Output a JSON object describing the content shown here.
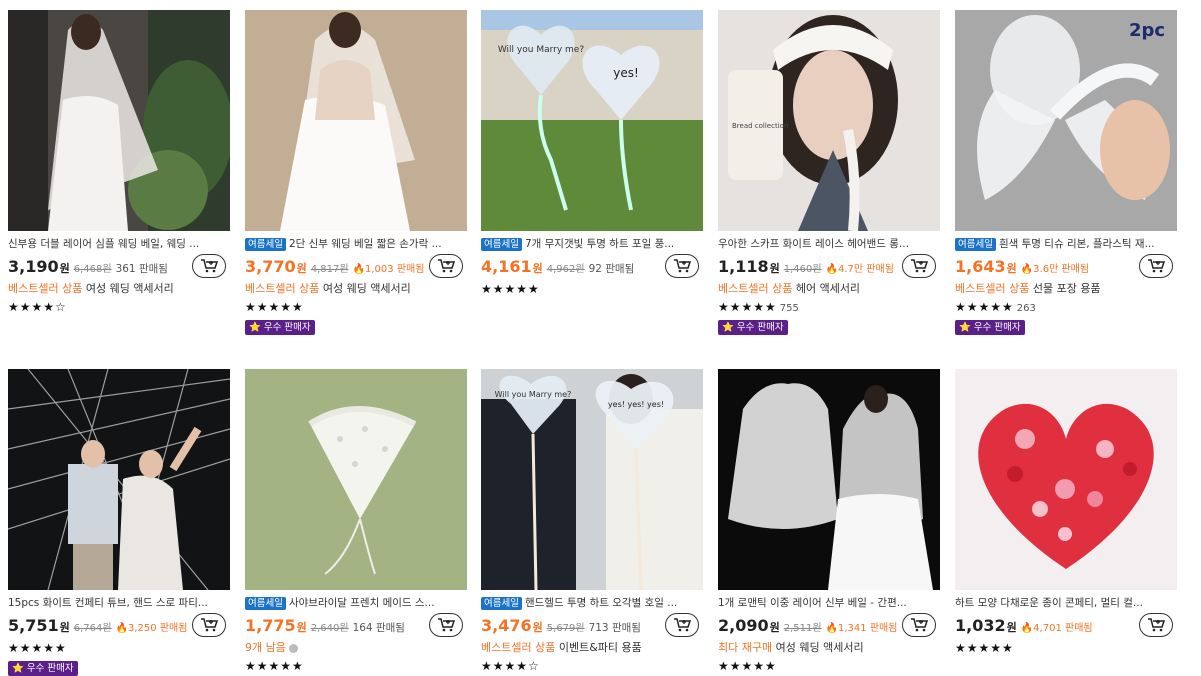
{
  "products": [
    {
      "title": "신부용 더블 레이어 심플 웨딩 베일, 웨딩 ...",
      "sale": false,
      "price": "3,190",
      "price_color": "black",
      "won": "원",
      "old": "6,468원",
      "fire": "",
      "sold": "361 판매됨",
      "line3_hi": "베스트셀러 상품",
      "line3_rest": " 여성 웨딩 액세서리",
      "stars": "★★★★☆",
      "reviews": "",
      "seller": ""
    },
    {
      "title": "2단 신부 웨딩 베일 짧은 손가락 ...",
      "sale": true,
      "price": "3,770",
      "price_color": "orange",
      "won": "원",
      "old": "4,817원",
      "fire": "🔥1,003 판매됨",
      "sold": "",
      "line3_hi": "베스트셀러 상품",
      "line3_rest": " 여성 웨딩 액세서리",
      "stars": "★★★★★",
      "reviews": "",
      "seller": "⭐ 우수 판매자"
    },
    {
      "title": "7개 무지갯빛 투명 하트 포일 풍...",
      "sale": true,
      "price": "4,161",
      "price_color": "orange",
      "won": "원",
      "old": "4,962원",
      "fire": "",
      "sold": "92 판매됨",
      "line3_hi": "",
      "line3_rest": "",
      "stars": "★★★★★",
      "reviews": "",
      "seller": ""
    },
    {
      "title": "우아한 스카프 화이트 레이스 헤어밴드 롱...",
      "sale": false,
      "price": "1,118",
      "price_color": "black",
      "won": "원",
      "old": "1,460원",
      "fire": "🔥4.7만 판매됨",
      "sold": "",
      "line3_hi": "베스트셀러 상품",
      "line3_rest": " 헤어 액세서리",
      "stars": "★★★★★",
      "reviews": "755",
      "seller": "⭐ 우수 판매자"
    },
    {
      "title": "흰색 투명 티슈 리본, 플라스틱 재...",
      "sale": true,
      "price": "1,643",
      "price_color": "orange",
      "won": "원",
      "old": "",
      "fire": "🔥3.6만 판매됨",
      "sold": "",
      "line3_hi": "베스트셀러 상품",
      "line3_rest": " 선물 포장 용품",
      "stars": "★★★★★",
      "reviews": "263",
      "seller": "⭐ 우수 판매자"
    },
    {
      "title": "15pcs 화이트 컨페티 튜브, 핸드 스로 파티...",
      "sale": false,
      "price": "5,751",
      "price_color": "black",
      "won": "원",
      "old": "6,764원",
      "fire": "🔥3,250 판매됨",
      "sold": "",
      "line3_hi": "",
      "line3_rest": "",
      "stars": "★★★★★",
      "reviews": "",
      "seller": "⭐ 우수 판매자"
    },
    {
      "title": "사야브라이달 프렌치 메이드 스...",
      "sale": true,
      "price": "1,775",
      "price_color": "orange",
      "won": "원",
      "old": "2,640원",
      "fire": "",
      "sold": "164 판매됨",
      "line3_hi": "9개 남음",
      "line3_rest": "",
      "stars": "★★★★★",
      "reviews": "",
      "seller": ""
    },
    {
      "title": "핸드헬드 투명 하트 오각별 호일 ...",
      "sale": true,
      "price": "3,476",
      "price_color": "orange",
      "won": "원",
      "old": "5,679원",
      "fire": "",
      "sold": "713 판매됨",
      "line3_hi": "베스트셀러 상품",
      "line3_rest": " 이벤트&파티 용품",
      "stars": "★★★★☆",
      "reviews": "",
      "seller": ""
    },
    {
      "title": "1개 로맨틱 이중 레이어 신부 베일 - 간편...",
      "sale": false,
      "price": "2,090",
      "price_color": "black",
      "won": "원",
      "old": "2,511원",
      "fire": "🔥1,341 판매됨",
      "sold": "",
      "line3_hi": "최다 재구매",
      "line3_rest": " 여성 웨딩 액세서리",
      "stars": "★★★★★",
      "reviews": "",
      "seller": ""
    },
    {
      "title": "하트 모양 다채로운 종이 콘페티, 멀티 컬...",
      "sale": false,
      "price": "1,032",
      "price_color": "black",
      "won": "원",
      "old": "",
      "fire": "🔥4,701 판매됨",
      "sold": "",
      "line3_hi": "",
      "line3_rest": "",
      "stars": "★★★★★",
      "reviews": "",
      "seller": ""
    }
  ],
  "labels": {
    "sale_badge": "여름세일",
    "pc_tag": "2pc",
    "balloon_text_1": "Will you Marry me?",
    "balloon_text_2": "yes!",
    "balloon_text_3": "yes! yes! yes!",
    "phone_text": "Bread collection"
  },
  "colors": {
    "accent_orange": "#f57224",
    "sale_blue": "#1a73c8",
    "seller_purple": "#5b1f8a"
  },
  "icons": {
    "cart": "cart-plus-icon",
    "star": "star-icon",
    "fire": "fire-icon"
  }
}
